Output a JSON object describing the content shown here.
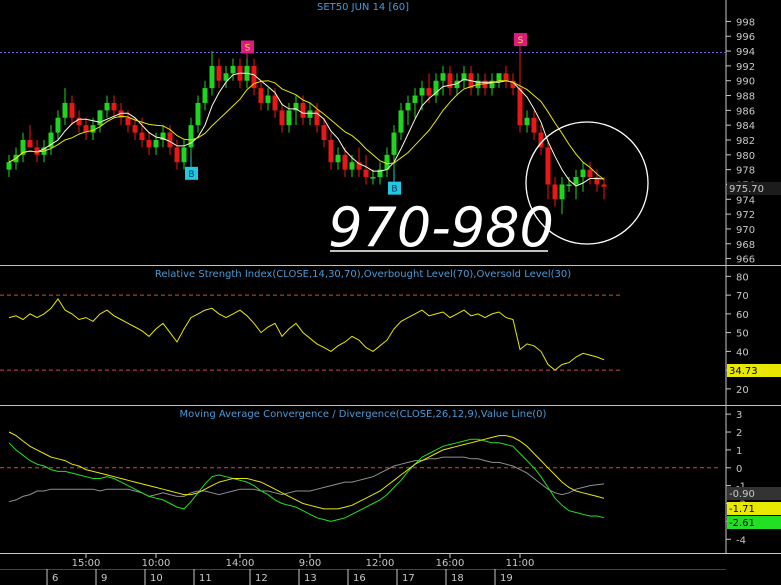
{
  "chart_data": {
    "type": "candlestick",
    "title": "SET50 JUN 14   [60]",
    "price_panel": {
      "ylim": [
        965,
        999
      ],
      "yticks": [
        966,
        968,
        970,
        972,
        974,
        976,
        978,
        980,
        982,
        984,
        986,
        988,
        990,
        992,
        994,
        996,
        998
      ],
      "last_value": "975.70",
      "resistance_level": 993.8,
      "annotation": "970-980",
      "signals": [
        {
          "label": "S",
          "bar": 34
        },
        {
          "label": "B",
          "bar": 26
        },
        {
          "label": "S",
          "bar": 73
        },
        {
          "label": "B",
          "bar": 55
        }
      ],
      "candles": [
        [
          978,
          980,
          977,
          979
        ],
        [
          979,
          981,
          978,
          980
        ],
        [
          980,
          983,
          979,
          982
        ],
        [
          982,
          984,
          981,
          981
        ],
        [
          981,
          982,
          979,
          980
        ],
        [
          980,
          982,
          979,
          981
        ],
        [
          981,
          984,
          980,
          983
        ],
        [
          983,
          986,
          982,
          985
        ],
        [
          985,
          989,
          984,
          987
        ],
        [
          987,
          988,
          984,
          985
        ],
        [
          985,
          986,
          983,
          984
        ],
        [
          984,
          985,
          982,
          983
        ],
        [
          983,
          985,
          982,
          984
        ],
        [
          984,
          986,
          983,
          986
        ],
        [
          986,
          988,
          985,
          987
        ],
        [
          987,
          988,
          985,
          986
        ],
        [
          986,
          987,
          984,
          985
        ],
        [
          985,
          986,
          983,
          984
        ],
        [
          984,
          985,
          982,
          983
        ],
        [
          983,
          985,
          981,
          982
        ],
        [
          982,
          983,
          980,
          981
        ],
        [
          981,
          983,
          980,
          982
        ],
        [
          982,
          984,
          981,
          983
        ],
        [
          983,
          984,
          980,
          981
        ],
        [
          981,
          982,
          978,
          979
        ],
        [
          979,
          982,
          978,
          981
        ],
        [
          981,
          985,
          980,
          984
        ],
        [
          984,
          988,
          983,
          987
        ],
        [
          987,
          990,
          986,
          989
        ],
        [
          989,
          994,
          988,
          992
        ],
        [
          992,
          993,
          989,
          990
        ],
        [
          990,
          992,
          989,
          991
        ],
        [
          991,
          993,
          990,
          992
        ],
        [
          992,
          993,
          989,
          990
        ],
        [
          990,
          993,
          989,
          992
        ],
        [
          992,
          993,
          988,
          989
        ],
        [
          989,
          990,
          986,
          987
        ],
        [
          987,
          989,
          986,
          988
        ],
        [
          988,
          989,
          985,
          986
        ],
        [
          986,
          987,
          983,
          984
        ],
        [
          984,
          987,
          983,
          986
        ],
        [
          986,
          988,
          984,
          987
        ],
        [
          987,
          988,
          984,
          985
        ],
        [
          985,
          987,
          984,
          986
        ],
        [
          986,
          987,
          983,
          984
        ],
        [
          984,
          985,
          981,
          982
        ],
        [
          982,
          983,
          978,
          979
        ],
        [
          979,
          981,
          978,
          980
        ],
        [
          980,
          981,
          977,
          978
        ],
        [
          978,
          980,
          977,
          979
        ],
        [
          979,
          981,
          977,
          978
        ],
        [
          978,
          980,
          976,
          977
        ],
        [
          977,
          978,
          976,
          977
        ],
        [
          977,
          979,
          976,
          978
        ],
        [
          978,
          981,
          977,
          980
        ],
        [
          980,
          984,
          978,
          983
        ],
        [
          983,
          987,
          982,
          986
        ],
        [
          986,
          988,
          984,
          987
        ],
        [
          987,
          989,
          985,
          988
        ],
        [
          988,
          990,
          986,
          989
        ],
        [
          989,
          991,
          987,
          988
        ],
        [
          988,
          991,
          987,
          990
        ],
        [
          990,
          992,
          988,
          991
        ],
        [
          991,
          992,
          988,
          989
        ],
        [
          989,
          991,
          988,
          990
        ],
        [
          990,
          992,
          989,
          991
        ],
        [
          991,
          992,
          988,
          989
        ],
        [
          989,
          991,
          988,
          990
        ],
        [
          990,
          991,
          988,
          989
        ],
        [
          989,
          991,
          988,
          990
        ],
        [
          990,
          991,
          989,
          991
        ],
        [
          991,
          992,
          989,
          990
        ],
        [
          990,
          991,
          988,
          989
        ],
        [
          989,
          994,
          983,
          984
        ],
        [
          984,
          986,
          983,
          985
        ],
        [
          985,
          986,
          982,
          983
        ],
        [
          983,
          984,
          980,
          981
        ],
        [
          981,
          982,
          974,
          976
        ],
        [
          976,
          977,
          973,
          974
        ],
        [
          974,
          977,
          972,
          976
        ],
        [
          976,
          977,
          975,
          976
        ],
        [
          976,
          978,
          974,
          977
        ],
        [
          977,
          979,
          975,
          978
        ],
        [
          978,
          979,
          976,
          977
        ],
        [
          977,
          978,
          975,
          976
        ],
        [
          976,
          977,
          974,
          975.7
        ]
      ]
    },
    "rsi_panel": {
      "label": "Relative Strength Index(CLOSE,14,30,70),Overbought Level(70),Oversold Level(30)",
      "ylim": [
        13,
        85
      ],
      "yticks": [
        20,
        30,
        40,
        50,
        60,
        70,
        80
      ],
      "overbought": 70,
      "oversold": 30,
      "last_value": "34.73",
      "values": [
        58,
        59,
        57,
        60,
        58,
        60,
        63,
        68,
        62,
        60,
        57,
        58,
        56,
        60,
        62,
        59,
        57,
        55,
        53,
        51,
        48,
        52,
        55,
        50,
        45,
        52,
        58,
        60,
        62,
        63,
        60,
        58,
        60,
        62,
        59,
        55,
        50,
        53,
        55,
        48,
        52,
        55,
        50,
        47,
        44,
        42,
        40,
        43,
        45,
        48,
        46,
        42,
        40,
        43,
        46,
        52,
        56,
        58,
        60,
        62,
        59,
        60,
        61,
        58,
        60,
        62,
        59,
        60,
        58,
        60,
        61,
        58,
        57,
        41,
        44,
        43,
        40,
        33,
        30,
        33,
        34,
        37,
        39,
        38,
        37,
        35.5
      ]
    },
    "macd_panel": {
      "label": "Moving Average Convergence / Divergence(CLOSE,26,12,9),Value Line(0)",
      "ylim": [
        -4.6,
        3.4
      ],
      "yticks": [
        -4,
        -3,
        -2,
        -1,
        0,
        1,
        2,
        3
      ],
      "value_line": 0,
      "last_values": [
        "-0.90",
        "-1.71",
        "-2.61"
      ],
      "macd": [
        1.4,
        1.0,
        0.7,
        0.4,
        0.2,
        0.1,
        -0.1,
        -0.2,
        -0.2,
        -0.3,
        -0.4,
        -0.5,
        -0.6,
        -0.6,
        -0.5,
        -0.6,
        -0.8,
        -1.0,
        -1.2,
        -1.4,
        -1.6,
        -1.7,
        -1.8,
        -2.0,
        -2.2,
        -2.3,
        -1.9,
        -1.4,
        -0.9,
        -0.5,
        -0.4,
        -0.5,
        -0.6,
        -0.7,
        -0.8,
        -1.0,
        -1.3,
        -1.5,
        -1.8,
        -2.0,
        -2.1,
        -2.2,
        -2.4,
        -2.6,
        -2.8,
        -2.9,
        -3.0,
        -2.9,
        -2.8,
        -2.6,
        -2.4,
        -2.2,
        -2.0,
        -1.8,
        -1.5,
        -1.1,
        -0.7,
        -0.2,
        0.2,
        0.6,
        0.8,
        1.0,
        1.2,
        1.3,
        1.4,
        1.5,
        1.6,
        1.6,
        1.5,
        1.4,
        1.4,
        1.3,
        1.2,
        0.8,
        0.4,
        0.0,
        -0.5,
        -1.1,
        -1.7,
        -2.1,
        -2.4,
        -2.5,
        -2.6,
        -2.7,
        -2.7,
        -2.8
      ],
      "signal": [
        2.0,
        1.8,
        1.5,
        1.2,
        1.0,
        0.8,
        0.6,
        0.5,
        0.4,
        0.2,
        0.1,
        -0.1,
        -0.2,
        -0.3,
        -0.4,
        -0.5,
        -0.6,
        -0.7,
        -0.8,
        -0.9,
        -1.0,
        -1.1,
        -1.2,
        -1.3,
        -1.4,
        -1.5,
        -1.5,
        -1.4,
        -1.2,
        -1.0,
        -0.8,
        -0.7,
        -0.6,
        -0.6,
        -0.6,
        -0.7,
        -0.8,
        -1.0,
        -1.2,
        -1.4,
        -1.6,
        -1.8,
        -2.0,
        -2.1,
        -2.2,
        -2.3,
        -2.3,
        -2.3,
        -2.2,
        -2.1,
        -1.9,
        -1.7,
        -1.5,
        -1.3,
        -1.0,
        -0.7,
        -0.4,
        -0.1,
        0.2,
        0.4,
        0.6,
        0.8,
        1.0,
        1.1,
        1.2,
        1.3,
        1.4,
        1.5,
        1.6,
        1.7,
        1.8,
        1.8,
        1.7,
        1.5,
        1.2,
        0.8,
        0.4,
        0.0,
        -0.4,
        -0.8,
        -1.1,
        -1.3,
        -1.4,
        -1.5,
        -1.6,
        -1.71
      ],
      "histogram": [
        -1.9,
        -1.8,
        -1.6,
        -1.5,
        -1.3,
        -1.3,
        -1.2,
        -1.2,
        -1.2,
        -1.2,
        -1.2,
        -1.2,
        -1.2,
        -1.3,
        -1.2,
        -1.2,
        -1.2,
        -1.2,
        -1.3,
        -1.4,
        -1.6,
        -1.5,
        -1.4,
        -1.5,
        -1.6,
        -1.6,
        -1.4,
        -1.3,
        -1.3,
        -1.4,
        -1.5,
        -1.4,
        -1.3,
        -1.2,
        -1.2,
        -1.2,
        -1.3,
        -1.3,
        -1.4,
        -1.5,
        -1.4,
        -1.3,
        -1.3,
        -1.3,
        -1.2,
        -1.1,
        -1.0,
        -0.9,
        -0.8,
        -0.8,
        -0.7,
        -0.6,
        -0.5,
        -0.3,
        -0.1,
        0.1,
        0.2,
        0.3,
        0.4,
        0.4,
        0.5,
        0.5,
        0.6,
        0.6,
        0.6,
        0.6,
        0.5,
        0.5,
        0.4,
        0.3,
        0.3,
        0.2,
        0.1,
        -0.1,
        -0.3,
        -0.6,
        -0.9,
        -1.2,
        -1.4,
        -1.5,
        -1.4,
        -1.2,
        -1.1,
        -1.0,
        -0.95,
        -0.9
      ]
    },
    "time_axis": {
      "time_labels": [
        {
          "label": "15:00",
          "bar": 11
        },
        {
          "label": "10:00",
          "bar": 21
        },
        {
          "label": "14:00",
          "bar": 33
        },
        {
          "label": "9:00",
          "bar": 43
        },
        {
          "label": "12:00",
          "bar": 53
        },
        {
          "label": "16:00",
          "bar": 63
        },
        {
          "label": "11:00",
          "bar": 73
        }
      ],
      "date_labels": [
        {
          "label": "6",
          "bar": 6
        },
        {
          "label": "9",
          "bar": 13
        },
        {
          "label": "10",
          "bar": 20
        },
        {
          "label": "11",
          "bar": 27
        },
        {
          "label": "12",
          "bar": 35
        },
        {
          "label": "13",
          "bar": 42
        },
        {
          "label": "16",
          "bar": 49
        },
        {
          "label": "17",
          "bar": 56
        },
        {
          "label": "18",
          "bar": 63
        },
        {
          "label": "19",
          "bar": 70
        }
      ]
    }
  }
}
